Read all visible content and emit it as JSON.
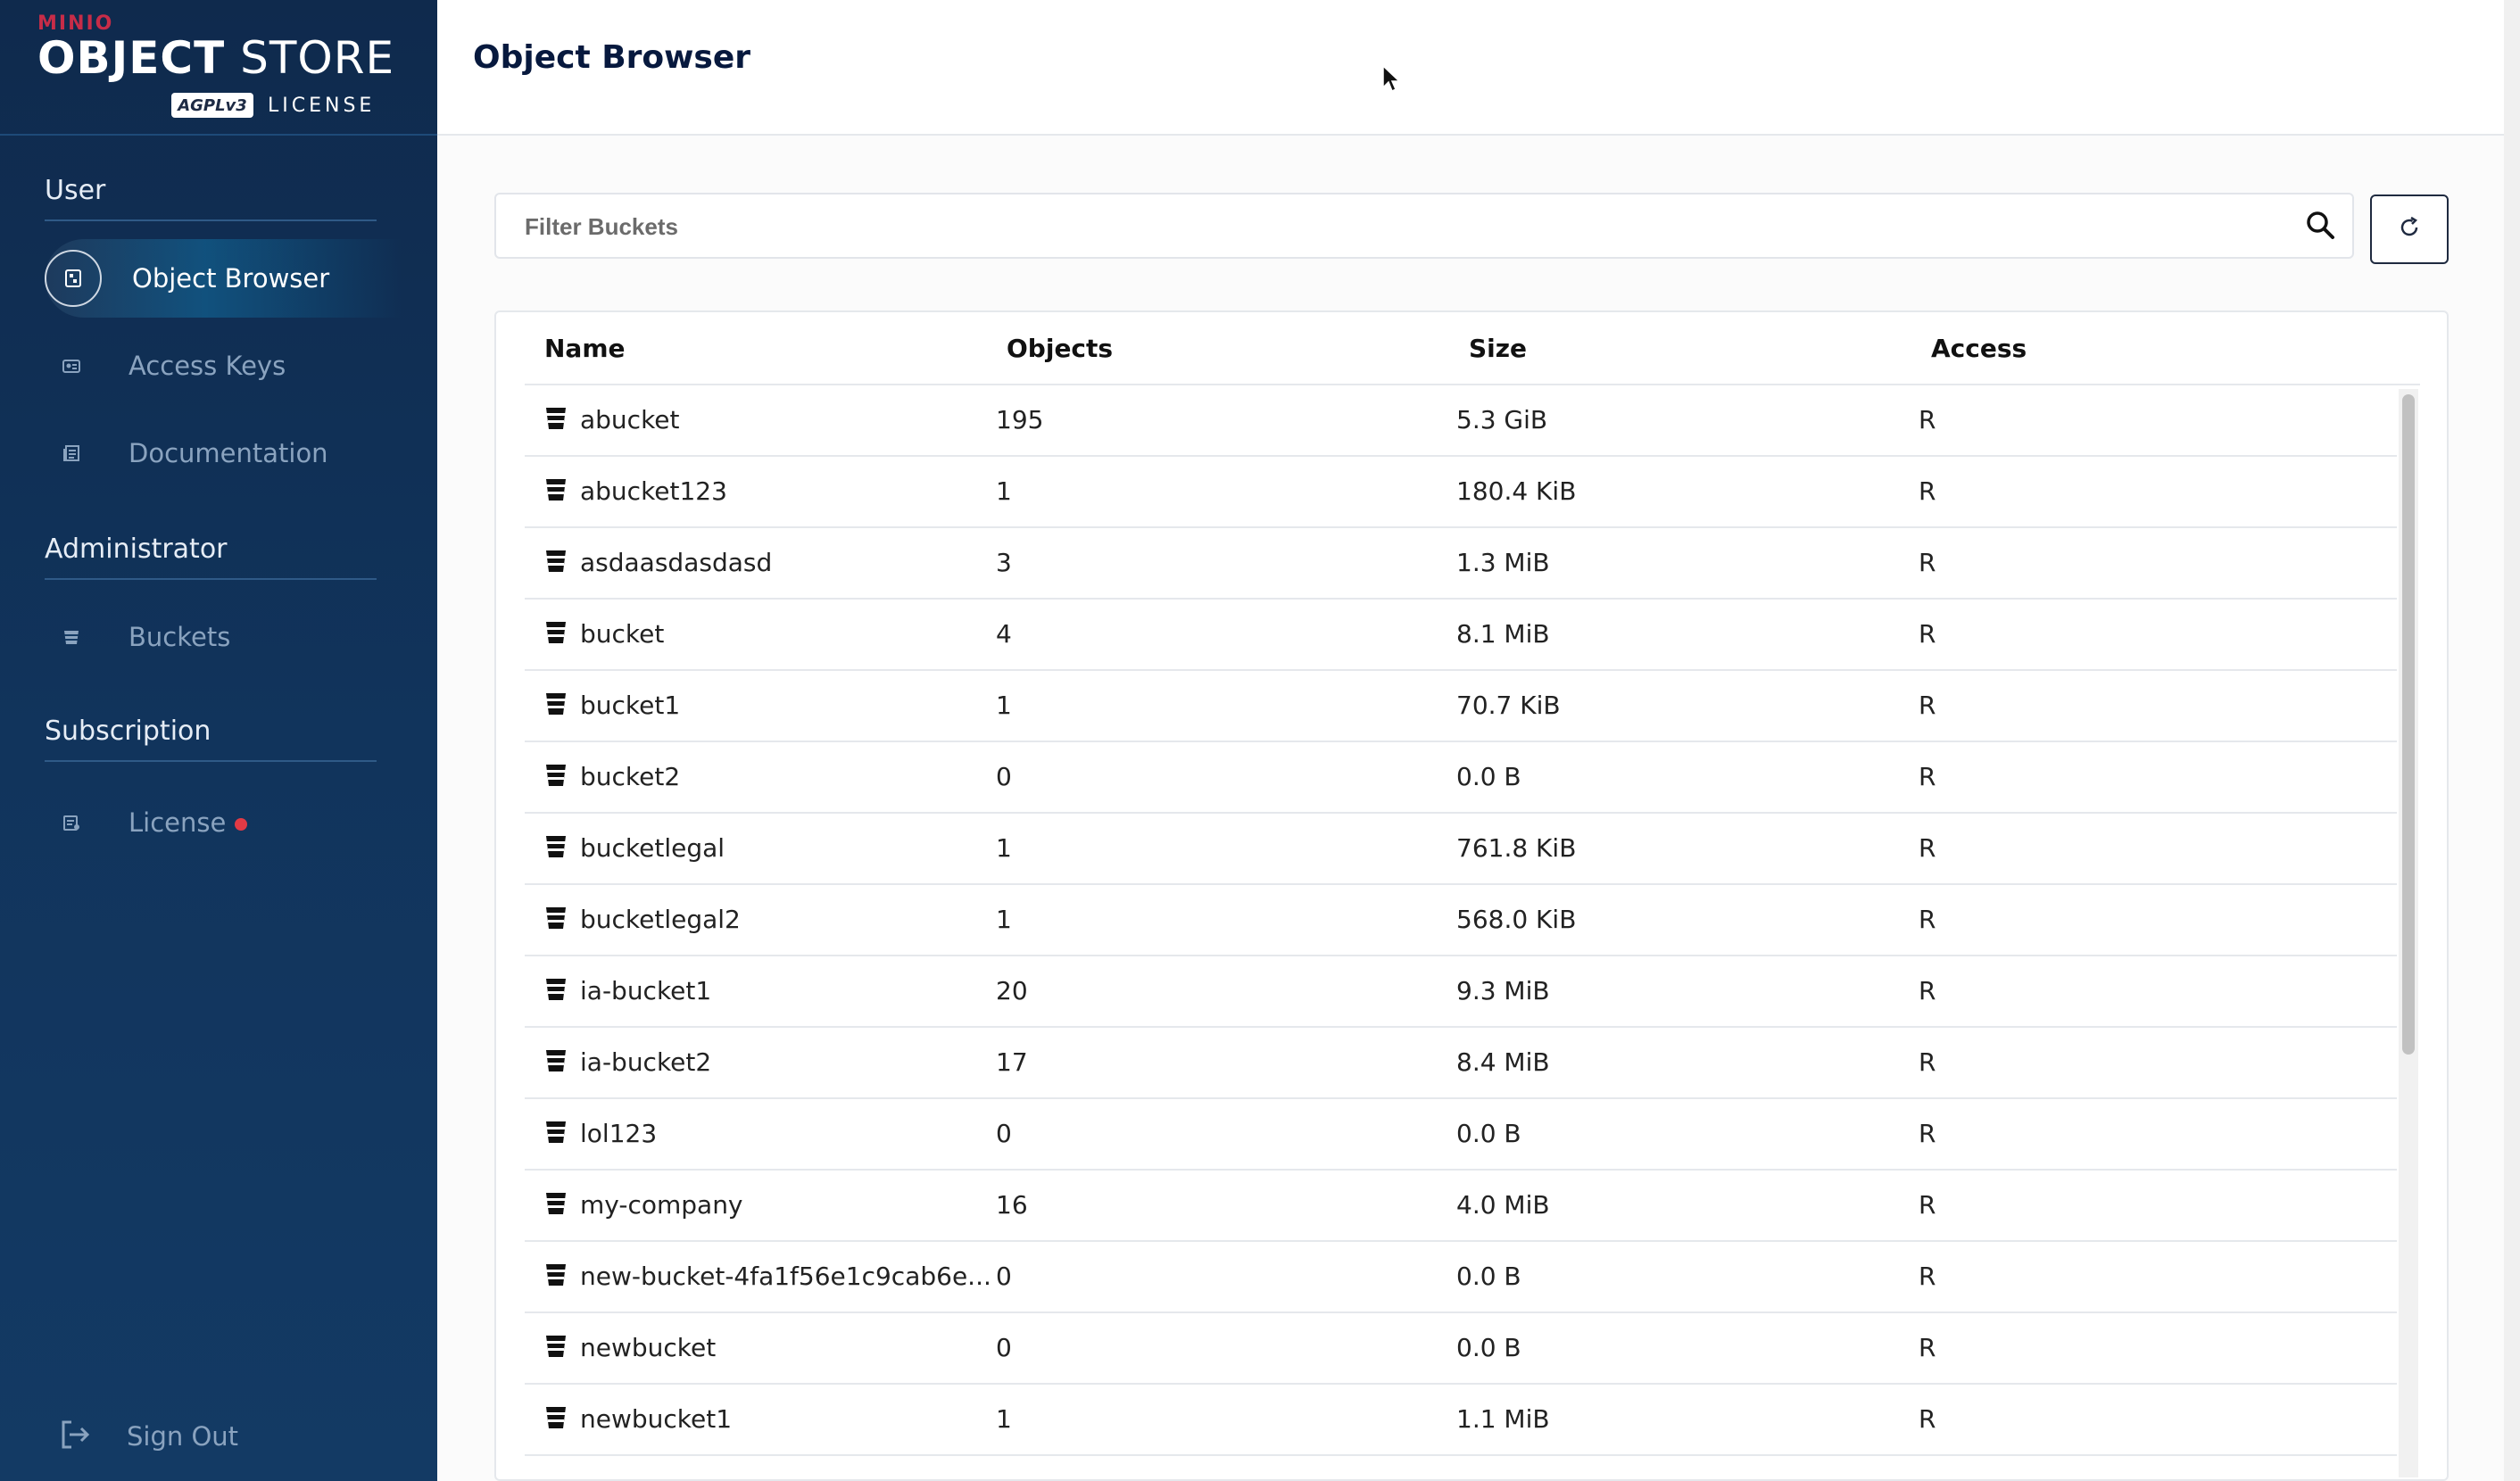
{
  "app": {
    "brand": "MINIO",
    "product_bold": "OBJECT",
    "product_rest": " STORE",
    "license_badge": "AGPLv3",
    "license_label": "LICENSE"
  },
  "sidebar": {
    "sections": {
      "user": "User",
      "administrator": "Administrator",
      "subscription": "Subscription"
    },
    "items": {
      "object_browser": "Object Browser",
      "access_keys": "Access Keys",
      "documentation": "Documentation",
      "buckets": "Buckets",
      "license": "License"
    },
    "sign_out": "Sign Out"
  },
  "header": {
    "title": "Object Browser"
  },
  "filter": {
    "placeholder": "Filter Buckets"
  },
  "table": {
    "columns": {
      "name": "Name",
      "objects": "Objects",
      "size": "Size",
      "access": "Access"
    },
    "rows": [
      {
        "name": "abucket",
        "objects": "195",
        "size": "5.3 GiB",
        "access": "R"
      },
      {
        "name": "abucket123",
        "objects": "1",
        "size": "180.4 KiB",
        "access": "R"
      },
      {
        "name": "asdaasdasdasd",
        "objects": "3",
        "size": "1.3 MiB",
        "access": "R"
      },
      {
        "name": "bucket",
        "objects": "4",
        "size": "8.1 MiB",
        "access": "R"
      },
      {
        "name": "bucket1",
        "objects": "1",
        "size": "70.7 KiB",
        "access": "R"
      },
      {
        "name": "bucket2",
        "objects": "0",
        "size": "0.0 B",
        "access": "R"
      },
      {
        "name": "bucketlegal",
        "objects": "1",
        "size": "761.8 KiB",
        "access": "R"
      },
      {
        "name": "bucketlegal2",
        "objects": "1",
        "size": "568.0 KiB",
        "access": "R"
      },
      {
        "name": "ia-bucket1",
        "objects": "20",
        "size": "9.3 MiB",
        "access": "R"
      },
      {
        "name": "ia-bucket2",
        "objects": "17",
        "size": "8.4 MiB",
        "access": "R"
      },
      {
        "name": "lol123",
        "objects": "0",
        "size": "0.0 B",
        "access": "R"
      },
      {
        "name": "my-company",
        "objects": "16",
        "size": "4.0 MiB",
        "access": "R"
      },
      {
        "name": "new-bucket-4fa1f56e1c9cab6e...",
        "objects": "0",
        "size": "0.0 B",
        "access": "R"
      },
      {
        "name": "newbucket",
        "objects": "0",
        "size": "0.0 B",
        "access": "R"
      },
      {
        "name": "newbucket1",
        "objects": "1",
        "size": "1.1 MiB",
        "access": "R"
      }
    ]
  },
  "colors": {
    "sidebar_bg": "#0f2a4d",
    "title_text": "#07193e",
    "license_dot": "#e23a45",
    "brand_red": "#c72c48"
  }
}
